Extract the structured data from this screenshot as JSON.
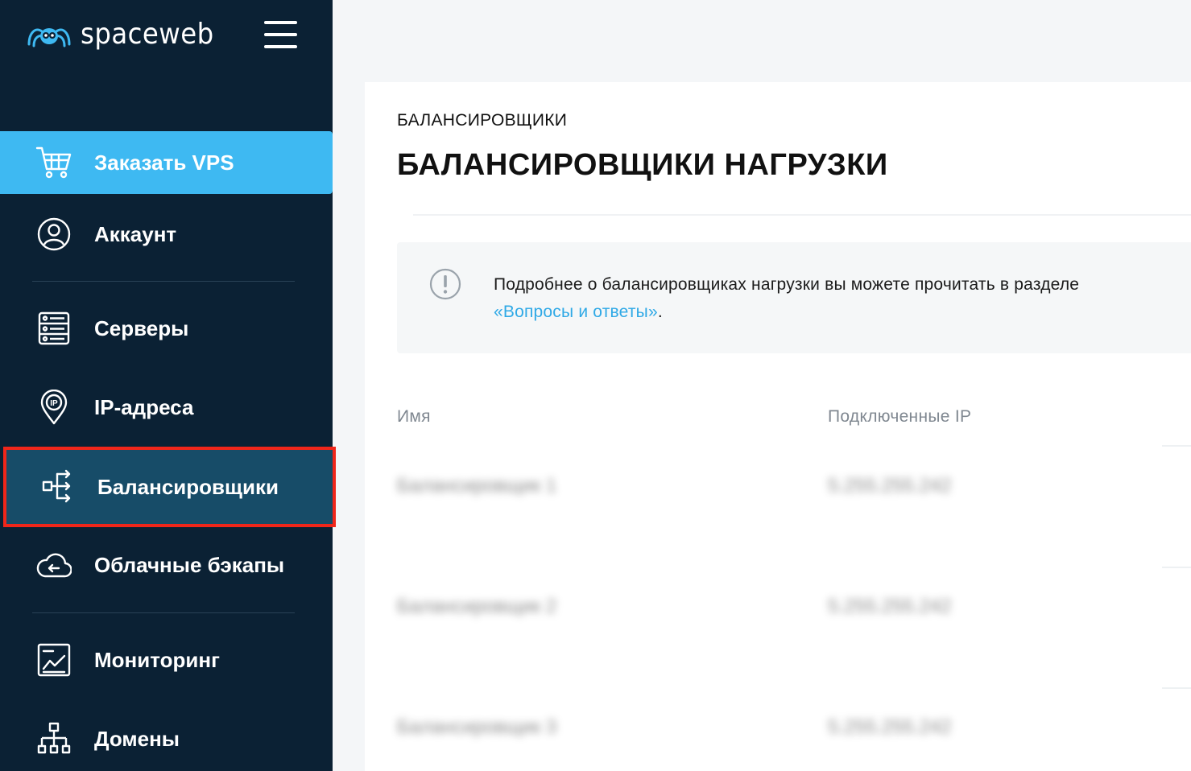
{
  "brand": {
    "logo_text": "spaceweb"
  },
  "sidebar": {
    "items": [
      {
        "label": "Заказать VPS",
        "icon": "cart-icon"
      },
      {
        "label": "Аккаунт",
        "icon": "user-circle-icon"
      },
      {
        "label": "Серверы",
        "icon": "server-icon"
      },
      {
        "label": "IP-адреса",
        "icon": "ip-pin-icon"
      },
      {
        "label": "Балансировщики",
        "icon": "balancer-icon"
      },
      {
        "label": "Облачные бэкапы",
        "icon": "cloud-backup-icon"
      },
      {
        "label": "Мониторинг",
        "icon": "monitoring-icon"
      },
      {
        "label": "Домены",
        "icon": "domains-icon"
      }
    ]
  },
  "main": {
    "breadcrumb": "БАЛАНСИРОВЩИКИ",
    "title": "БАЛАНСИРОВЩИКИ НАГРУЗКИ",
    "info": {
      "text_before": "Подробнее о балансировщиках нагрузки вы можете прочитать в разделе ",
      "link_text": "«Вопросы и ответы»",
      "text_after": "."
    },
    "table": {
      "columns": [
        "Имя",
        "Подключенные IP"
      ],
      "rows": [
        {
          "name": "Балансировщик 1",
          "ip": "5.255.255.242"
        },
        {
          "name": "Балансировщик 2",
          "ip": "5.255.255.242"
        },
        {
          "name": "Балансировщик 3",
          "ip": "5.255.255.242"
        }
      ]
    }
  },
  "colors": {
    "sidebar_bg": "#0b2134",
    "accent": "#3eb9f2",
    "active_bg": "#174c68",
    "highlight": "#f0261a",
    "link": "#2fa9e6"
  }
}
